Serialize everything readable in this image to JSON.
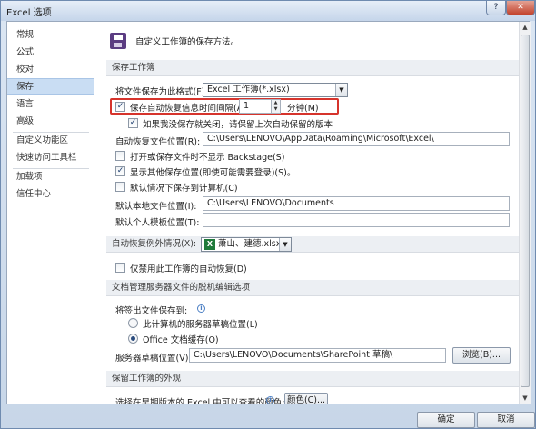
{
  "window": {
    "title": "Excel 选项",
    "help_glyph": "?",
    "close_glyph": "✕"
  },
  "sidebar": {
    "items": [
      {
        "label": "常规"
      },
      {
        "label": "公式"
      },
      {
        "label": "校对"
      },
      {
        "label": "保存"
      },
      {
        "label": "语言"
      },
      {
        "label": "高级"
      },
      {
        "label": "自定义功能区"
      },
      {
        "label": "快速访问工具栏"
      },
      {
        "label": "加载项"
      },
      {
        "label": "信任中心"
      }
    ],
    "active": "保存"
  },
  "header": {
    "text": "自定义工作簿的保存方法。",
    "icon": "save-floppy-icon"
  },
  "save_section": {
    "title": "保存工作簿",
    "format_label": "将文件保存为此格式(F):",
    "format_value": "Excel 工作簿(*.xlsx)",
    "autorecover_label": "保存自动恢复信息时间间隔(A)",
    "autorecover_checked": true,
    "autorecover_minutes": "1",
    "minutes_label": "分钟(M)",
    "keep_last_label": "如果我没保存就关闭，请保留上次自动保留的版本",
    "keep_last_checked": true,
    "autorecover_location_label": "自动恢复文件位置(R):",
    "autorecover_location_value": "C:\\Users\\LENOVO\\AppData\\Roaming\\Microsoft\\Excel\\",
    "no_backstage_label": "打开或保存文件时不显示 Backstage(S)",
    "no_backstage_checked": false,
    "show_extra_label": "显示其他保存位置(即使可能需要登录)(S)。",
    "show_extra_checked": true,
    "default_computer_label": "默认情况下保存到计算机(C)",
    "default_computer_checked": false,
    "default_local_label": "默认本地文件位置(I):",
    "default_local_value": "C:\\Users\\LENOVO\\Documents",
    "default_template_label": "默认个人模板位置(T):",
    "default_template_value": ""
  },
  "exceptions_section": {
    "title": "自动恢复例外情况(X):",
    "workbook_value": "萧山、建德.xlsx",
    "disable_label": "仅禁用此工作簿的自动恢复(D)",
    "disable_checked": false
  },
  "offline_section": {
    "title": "文档管理服务器文件的脱机编辑选项",
    "save_to_label": "将签出文件保存到:",
    "radio_server_label": "此计算机的服务器草稿位置(L)",
    "radio_office_label": "Office 文档缓存(O)",
    "selected": "office",
    "drafts_label": "服务器草稿位置(V):",
    "drafts_value": "C:\\Users\\LENOVO\\Documents\\SharePoint 草稿\\",
    "browse_label": "浏览(B)..."
  },
  "appearance_section": {
    "title": "保留工作簿的外观",
    "colors_label": "选择在早期版本的 Excel 中可以查看的颜色:",
    "colors_button": "颜色(C)..."
  },
  "footer": {
    "ok_label": "确定",
    "cancel_label": "取消"
  }
}
